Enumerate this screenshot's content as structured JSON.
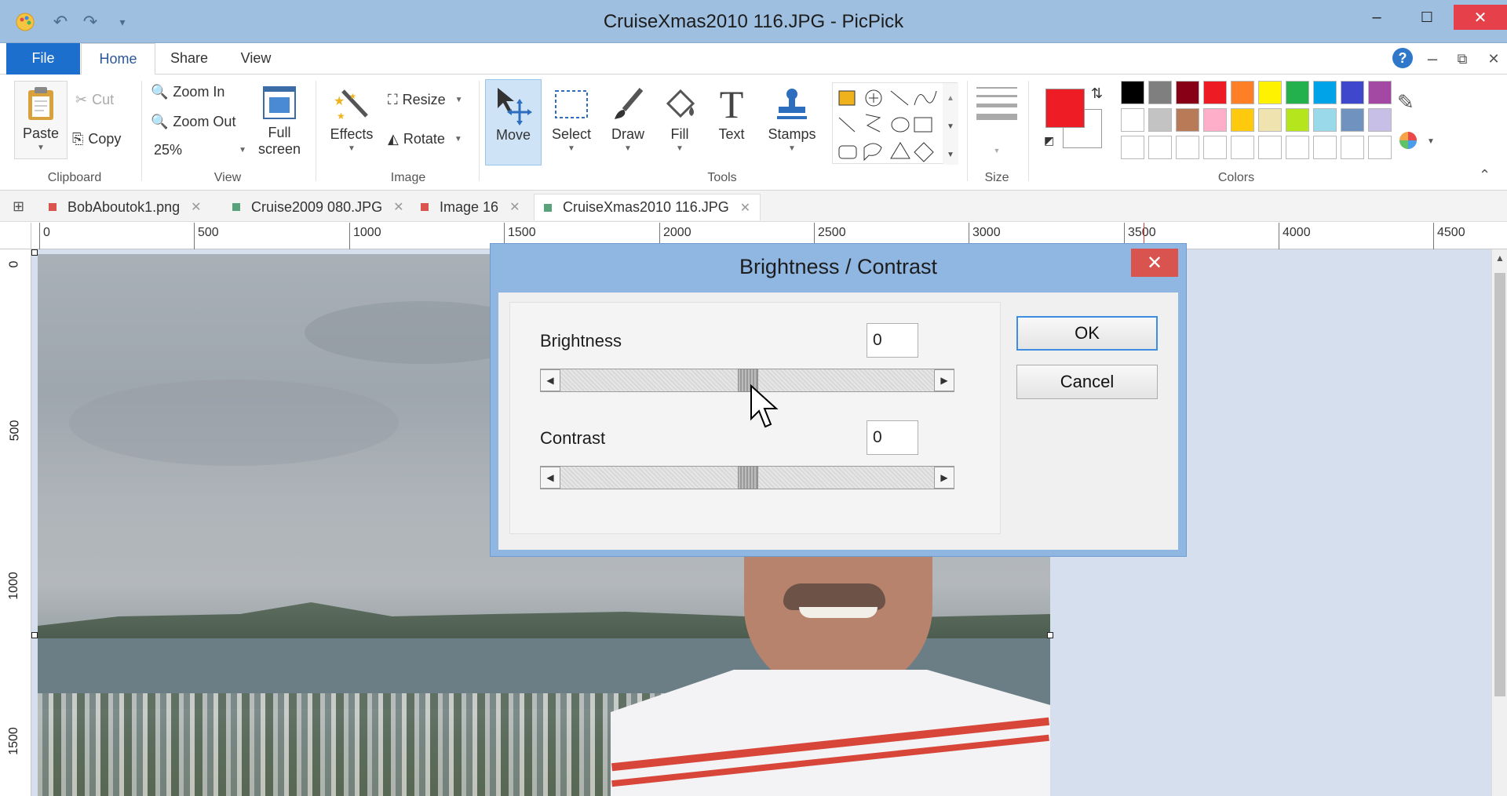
{
  "window": {
    "title": "CruiseXmas2010 116.JPG - PicPick",
    "minimize": "–",
    "maximize": "☐",
    "close": "✕"
  },
  "ribbon_tabs": [
    "File",
    "Home",
    "Share",
    "View"
  ],
  "ribbon_right": {
    "help": "?",
    "minimize": "–",
    "restore": "⧉",
    "close": "✕"
  },
  "clipboard": {
    "paste": "Paste",
    "cut": "Cut",
    "copy": "Copy",
    "group": "Clipboard"
  },
  "view": {
    "zoom_in": "Zoom In",
    "zoom_out": "Zoom Out",
    "zoom_level": "25%",
    "full_screen_1": "Full",
    "full_screen_2": "screen",
    "group": "View"
  },
  "image": {
    "effects": "Effects",
    "resize": "Resize",
    "rotate": "Rotate",
    "group": "Image"
  },
  "tools": {
    "move": "Move",
    "select": "Select",
    "draw": "Draw",
    "fill": "Fill",
    "text": "Text",
    "stamps": "Stamps",
    "group": "Tools"
  },
  "size": {
    "group": "Size"
  },
  "colors": {
    "group": "Colors",
    "primary": "#ee1c24",
    "secondary": "#ffffff",
    "palette_row1": [
      "#000000",
      "#7f7f7f",
      "#880015",
      "#ed1c24",
      "#ff7f27",
      "#fff200",
      "#22b14c",
      "#00a2e8",
      "#3f48cc",
      "#a349a4"
    ],
    "palette_row2": [
      "#ffffff",
      "#c3c3c3",
      "#b97a57",
      "#ffaec9",
      "#ffc90e",
      "#efe4b0",
      "#b5e61d",
      "#99d9ea",
      "#7092be",
      "#c8bfe7"
    ]
  },
  "doc_tabs": [
    {
      "name": "BobAboutok1.png",
      "color": "#d9534f"
    },
    {
      "name": "Cruise2009 080.JPG",
      "color": "#5aa27c"
    },
    {
      "name": "Image 16",
      "color": "#d9534f"
    },
    {
      "name": "CruiseXmas2010 116.JPG",
      "color": "#5aa27c"
    }
  ],
  "ruler": {
    "h": [
      "0",
      "500",
      "1000",
      "1500",
      "2000",
      "2500",
      "3000",
      "3500",
      "4000",
      "4500"
    ],
    "v": [
      "0",
      "500",
      "1000",
      "1500"
    ]
  },
  "dialog": {
    "title": "Brightness / Contrast",
    "close": "✕",
    "brightness_label": "Brightness",
    "brightness_value": "0",
    "contrast_label": "Contrast",
    "contrast_value": "0",
    "ok": "OK",
    "cancel": "Cancel"
  }
}
